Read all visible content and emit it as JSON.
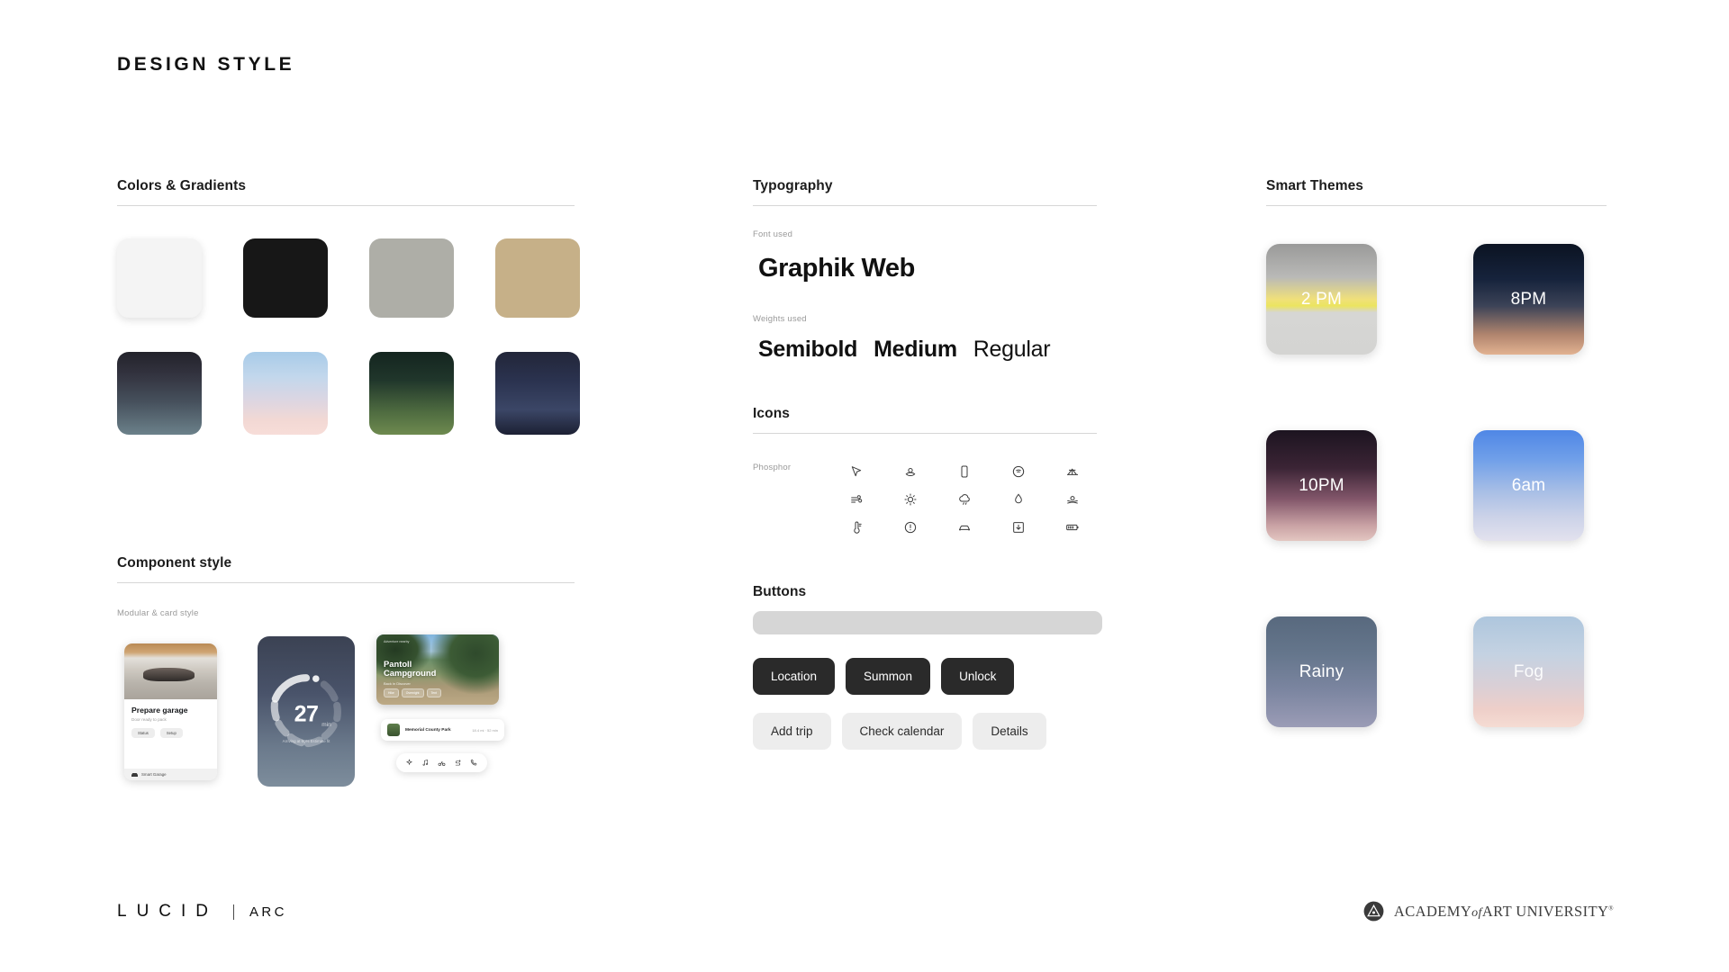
{
  "page": {
    "title": "DESIGN STYLE"
  },
  "colors_section": {
    "heading": "Colors & Gradients",
    "solids": [
      {
        "name": "off-white",
        "hex": "#f4f4f4"
      },
      {
        "name": "near-black",
        "hex": "#171717"
      },
      {
        "name": "warm-gray",
        "hex": "#aeaea7"
      },
      {
        "name": "sand-tan",
        "hex": "#c6b088"
      }
    ],
    "gradients": [
      {
        "name": "dusk-slate",
        "css": "linear-gradient(180deg,#23232b 0%,#32323e 26%,#46505c 60%,#6b818a 100%)"
      },
      {
        "name": "sky-blush",
        "css": "linear-gradient(180deg,#a8cbe8 0%,#c2d7ec 30%,#dcd6e2 58%,#f2d8d4 82%,#f7ddd8 100%)"
      },
      {
        "name": "forest-olive",
        "css": "linear-gradient(180deg,#14251f 0%,#20362b 34%,#4e6b40 72%,#6e8a4f 100%)"
      },
      {
        "name": "midnight-navy",
        "css": "linear-gradient(180deg,#222639 0%,#2b3350 36%,#3b4666 70%,#1c2033 100%)"
      }
    ]
  },
  "component_section": {
    "heading": "Component style",
    "sub_label": "Modular & card style",
    "card_garage": {
      "title": "Prepare garage",
      "subtitle": "Door ready to pack",
      "chips": [
        "Status",
        "Setup"
      ],
      "footer_label": "Smart Garage"
    },
    "card_charge": {
      "pill": "",
      "value": "27",
      "unit": "min",
      "note": "Arriving at 60% Estimate fit"
    },
    "card_camp": {
      "hero_eyebrow": "Adventure nearby",
      "hero_title_line1": "Pantoll",
      "hero_title_line2": "Campground",
      "hero_sub": "Back in Discover",
      "hero_chips": [
        "Hike",
        "Overnight",
        "Tent"
      ],
      "list_name": "Memorial County Park",
      "list_meta": "18.4 mi · 52 min",
      "toolbar_icons": [
        "sparkle-icon",
        "music-note-icon",
        "bike-icon",
        "route-icon",
        "phone-icon"
      ]
    }
  },
  "typography_section": {
    "heading": "Typography",
    "font_used_label": "Font used",
    "font_name": "Graphik Web",
    "weights_label": "Weights used",
    "weights": [
      "Semibold",
      "Medium",
      "Regular"
    ]
  },
  "icons_section": {
    "heading": "Icons",
    "library_label": "Phosphor",
    "icons": [
      "navigation-arrow-icon",
      "map-pin-icon",
      "phone-icon",
      "wifi-icon",
      "tent-icon",
      "fan-airflow-icon",
      "sun-icon",
      "cloud-rain-icon",
      "drop-icon",
      "campfire-icon",
      "thermometer-icon",
      "warning-circle-icon",
      "car-icon",
      "download-icon",
      "battery-icon"
    ]
  },
  "buttons_section": {
    "heading": "Buttons",
    "primary": [
      "Location",
      "Summon",
      "Unlock"
    ],
    "secondary": [
      "Add trip",
      "Check calendar",
      "Details"
    ],
    "primary_color": "#2a2a2a",
    "secondary_color": "#ededed"
  },
  "themes_section": {
    "heading": "Smart Themes",
    "themes": [
      {
        "label": "2 PM",
        "name": "afternoon"
      },
      {
        "label": "8PM",
        "name": "evening"
      },
      {
        "label": "10PM",
        "name": "night"
      },
      {
        "label": "6am",
        "name": "morning"
      },
      {
        "label": "Rainy",
        "name": "rainy"
      },
      {
        "label": "Fog",
        "name": "fog"
      }
    ]
  },
  "footer": {
    "brand_primary": "LUCID",
    "brand_secondary": "ARC",
    "university_word1": "ACADEMY",
    "university_word2": "of",
    "university_word3": "ART UNIVERSITY",
    "university_mark": "®"
  }
}
